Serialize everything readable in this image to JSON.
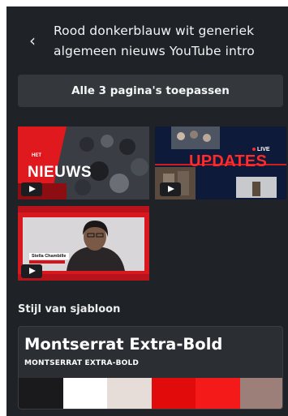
{
  "header": {
    "back_icon": "chevron-left-icon",
    "title": "Rood donkerblauw wit generiek algemeen nieuws YouTube intro"
  },
  "apply_button": {
    "label": "Alle 3 pagina's toepassen"
  },
  "thumbnails": [
    {
      "icon": "play-icon",
      "headline_tag": "HET",
      "headline": "NIEUWS"
    },
    {
      "icon": "play-icon",
      "live_label": "LIVE",
      "headline": "UPDATES"
    },
    {
      "icon": "play-icon",
      "name_tag": "Stella Chambille"
    }
  ],
  "style_section": {
    "label": "Stijl van sjabloon",
    "font_name": "Montserrat Extra-Bold",
    "font_name_caps": "MONTSERRAT EXTRA-BOLD",
    "palette": [
      "#1a1a1c",
      "#ffffff",
      "#e6ddd9",
      "#e20b0b",
      "#f41a1a",
      "#9d7f79"
    ]
  },
  "colors": {
    "panel_bg": "#1f2226",
    "button_bg": "#34383d",
    "accent_red": "#e3151c"
  }
}
